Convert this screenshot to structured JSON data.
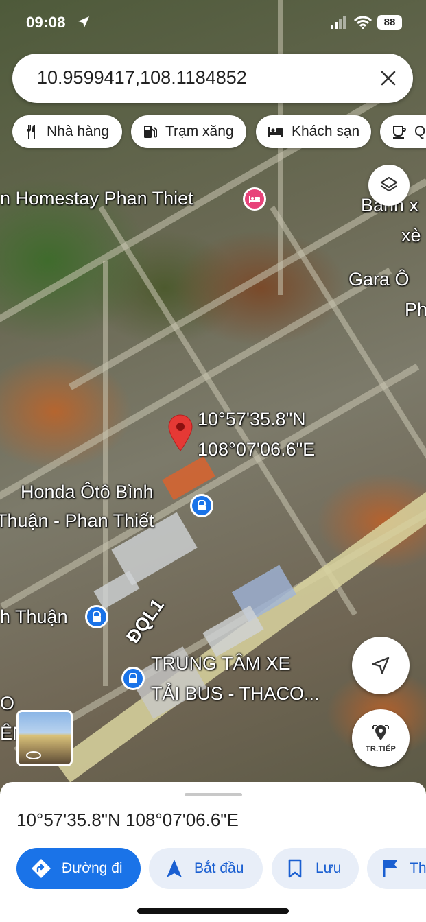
{
  "status_bar": {
    "time": "09:08",
    "battery": "88"
  },
  "search": {
    "query": "10.9599417,108.1184852"
  },
  "chips": [
    {
      "label": "Nhà hàng",
      "icon": "fork-knife-icon"
    },
    {
      "label": "Trạm xăng",
      "icon": "gas-station-icon"
    },
    {
      "label": "Khách sạn",
      "icon": "bed-icon"
    },
    {
      "label": "Qu",
      "icon": "cup-icon"
    }
  ],
  "map": {
    "labels": {
      "homestay": "n Homestay Phan Thiet",
      "banh_1": "Bánh x",
      "banh_2": "xè",
      "gara_1": "Gara Ô",
      "gara_2": "Ph",
      "pin_lat": "10°57'35.8\"N",
      "pin_lng": "108°07'06.6\"E",
      "honda_1": "Honda Ôtô Bình",
      "honda_2": "Thuận - Phan Thiết",
      "binh_thuan": "h Thuận",
      "road": "ĐQL1",
      "trungtam_1": "TRUNG TÂM XE",
      "trungtam_2": "TẢI BUS - THACO...",
      "left_1": "O",
      "left_2": "ÊN"
    },
    "street_view_button": "TR.TIẾP"
  },
  "sheet": {
    "coordinates": "10°57'35.8\"N 108°07'06.6\"E",
    "actions": [
      {
        "label": "Đường đi",
        "icon": "directions-icon"
      },
      {
        "label": "Bắt đầu",
        "icon": "navigation-arrow-icon"
      },
      {
        "label": "Lưu",
        "icon": "bookmark-icon"
      },
      {
        "label": "Th",
        "icon": "flag-icon"
      }
    ]
  },
  "colors": {
    "accent": "#1a73e8",
    "pin": "#e53935",
    "hotel": "#e8437a"
  }
}
